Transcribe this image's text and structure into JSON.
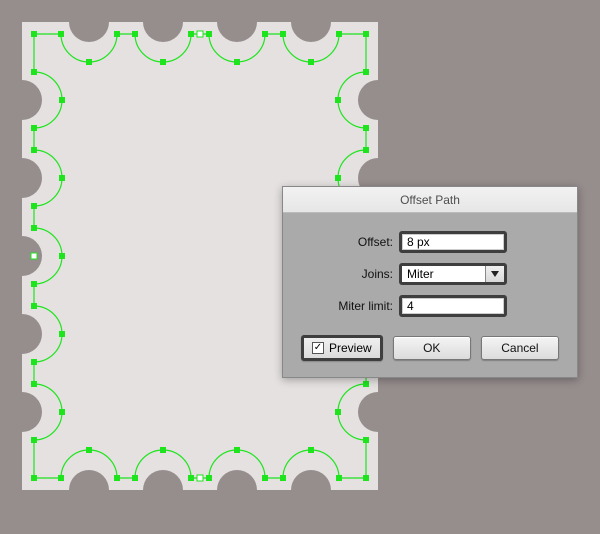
{
  "dialog": {
    "title": "Offset Path",
    "offset_label": "Offset:",
    "offset_value": "8 px",
    "joins_label": "Joins:",
    "joins_value": "Miter",
    "miter_label": "Miter limit:",
    "miter_value": "4",
    "preview_label": "Preview",
    "preview_checked": "☑",
    "ok_label": "OK",
    "cancel_label": "Cancel"
  },
  "shape": {
    "fill": "#e5e1e1",
    "notch_fill": "#968d8d",
    "path_stroke": "#1ee41e",
    "anchor_fill": "#1ee41e"
  }
}
